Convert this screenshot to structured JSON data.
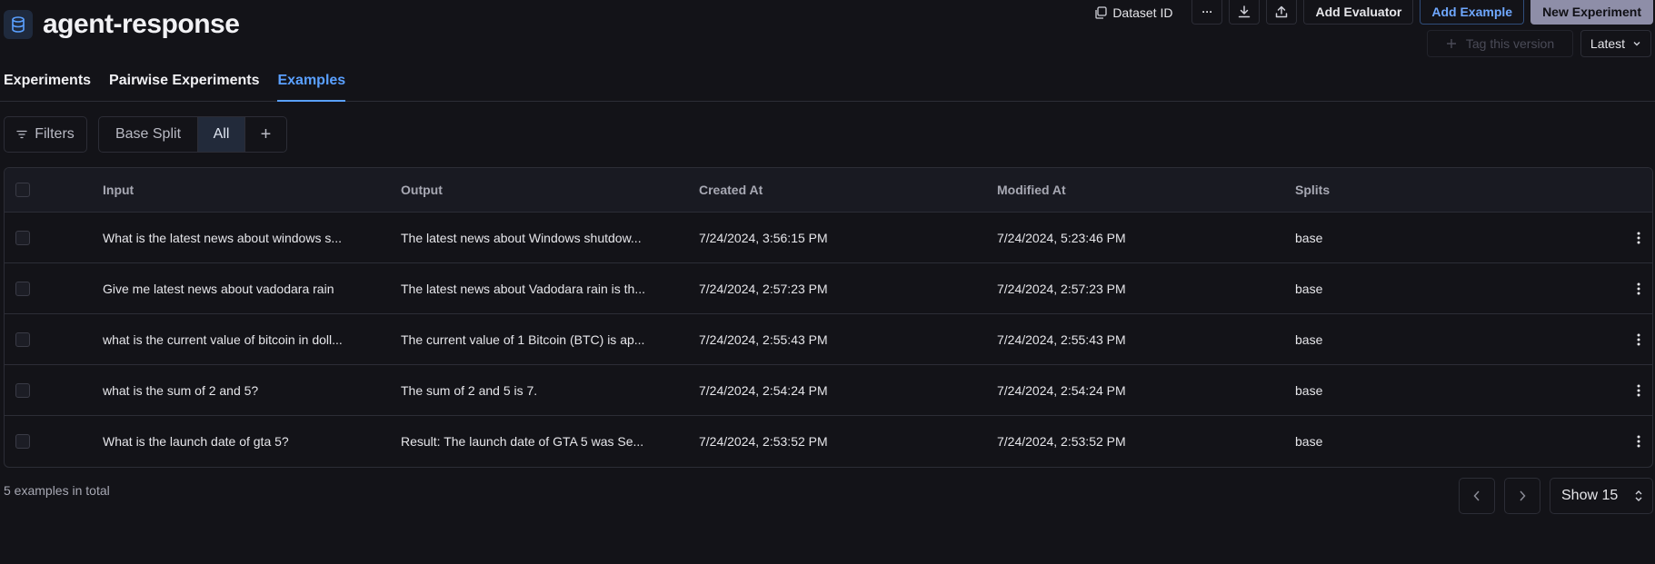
{
  "header": {
    "title": "agent-response",
    "icon": "database-icon"
  },
  "toolbar": {
    "dataset_id_label": "Dataset ID",
    "more_label": "···",
    "add_evaluator_label": "Add Evaluator",
    "add_example_label": "Add Example",
    "new_experiment_label": "New Experiment",
    "tag_version_label": "Tag this version",
    "version_label": "Latest"
  },
  "tabs": [
    {
      "label": "Experiments",
      "active": false
    },
    {
      "label": "Pairwise Experiments",
      "active": false
    },
    {
      "label": "Examples",
      "active": true
    }
  ],
  "filters": {
    "filters_label": "Filters",
    "split_label": "Base Split",
    "all_label": "All",
    "add_label": "+"
  },
  "table": {
    "columns": [
      "Input",
      "Output",
      "Created At",
      "Modified At",
      "Splits"
    ],
    "rows": [
      {
        "input": "What is the latest news about windows s...",
        "output": "The latest news about Windows shutdow...",
        "created": "7/24/2024, 3:56:15 PM",
        "modified": "7/24/2024, 5:23:46 PM",
        "splits": "base"
      },
      {
        "input": "Give me latest news about vadodara rain",
        "output": "The latest news about Vadodara rain is th...",
        "created": "7/24/2024, 2:57:23 PM",
        "modified": "7/24/2024, 2:57:23 PM",
        "splits": "base"
      },
      {
        "input": "what is the current value of bitcoin in doll...",
        "output": "The current value of 1 Bitcoin (BTC) is ap...",
        "created": "7/24/2024, 2:55:43 PM",
        "modified": "7/24/2024, 2:55:43 PM",
        "splits": "base"
      },
      {
        "input": "what is the sum of 2 and 5?",
        "output": "The sum of 2 and 5 is 7.",
        "created": "7/24/2024, 2:54:24 PM",
        "modified": "7/24/2024, 2:54:24 PM",
        "splits": "base"
      },
      {
        "input": "What is the launch date of gta 5?",
        "output": "Result: The launch date of GTA 5 was Se...",
        "created": "7/24/2024, 2:53:52 PM",
        "modified": "7/24/2024, 2:53:52 PM",
        "splits": "base"
      }
    ]
  },
  "footer": {
    "total_label": "5 examples in total",
    "show_label": "Show 15"
  },
  "colors": {
    "background": "#131318",
    "accent": "#5aa0ff",
    "border": "#2c2d36",
    "primary_button": "#8e8ea8"
  }
}
